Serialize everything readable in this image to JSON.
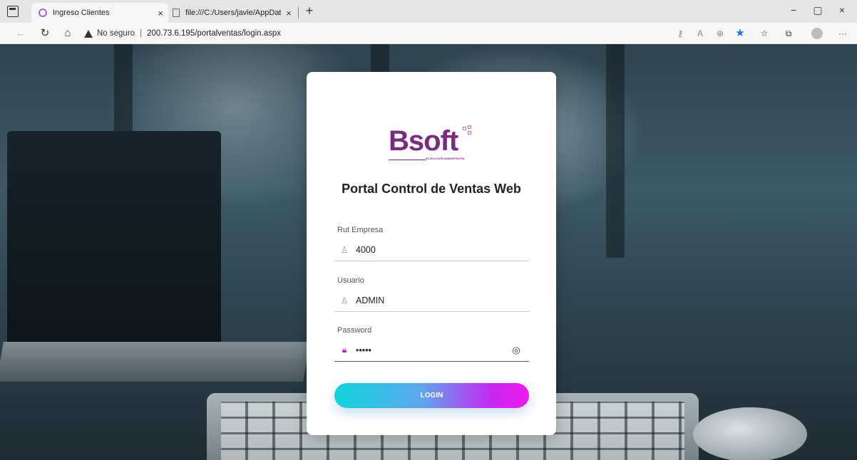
{
  "browser": {
    "tabs": [
      {
        "title": "Ingreso Clientes",
        "close": "×"
      },
      {
        "title": "file:///C:/Users/javie/AppData/Lo",
        "close": "×"
      }
    ],
    "new_tab": "+",
    "window_controls": {
      "minimize": "−",
      "restore": "▢",
      "close": "×"
    },
    "address": {
      "security": "No seguro",
      "separator": "|",
      "url": "200.73.6.195/portalventas/login.aspx"
    },
    "more": "···"
  },
  "login": {
    "logo_text": "Bsoft",
    "logo_subtitle": "SU SOLUCIÓN ADMINISTRATIVA",
    "heading": "Portal Control de Ventas Web",
    "fields": [
      {
        "label": "Rut Empresa",
        "value": "4000",
        "icon": "user-icon"
      },
      {
        "label": "Usuario",
        "value": "ADMIN",
        "icon": "user-icon"
      },
      {
        "label": "Password",
        "value": "•••••",
        "icon": "lock-icon"
      }
    ],
    "button": "LOGIN"
  },
  "colors": {
    "logo": "#7a2b7e",
    "lock": "#b01ad6",
    "button_start": "#10d4dc",
    "button_end": "#f01af0"
  }
}
